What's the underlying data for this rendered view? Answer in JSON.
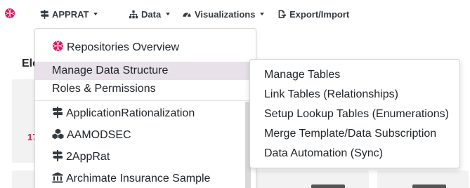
{
  "navbar": {
    "logo_icon": "appraat-logo-icon",
    "items": [
      {
        "label": "APPRAT",
        "icon": "signpost-icon"
      },
      {
        "label": "Data",
        "icon": "sitemap-icon"
      },
      {
        "label": "Visualizations",
        "icon": "tachometer-icon"
      },
      {
        "label": "Export/Import",
        "icon": "file-export-icon"
      }
    ]
  },
  "background": {
    "section_title": "Ele",
    "card_value": "17"
  },
  "dropdown": {
    "items": [
      {
        "label": "Repositories Overview",
        "icon": "appraat-logo-icon"
      },
      {
        "label": "Manage Data Structure",
        "active": true
      },
      {
        "label": "Roles & Permissions"
      },
      {
        "label": "ApplicationRationalization",
        "icon": "signpost-icon"
      },
      {
        "label": "AAMODSEC",
        "icon": "cubes-icon"
      },
      {
        "label": "2AppRat",
        "icon": "signpost-icon"
      },
      {
        "label": "Archimate Insurance Sample",
        "icon": "landmark-icon"
      }
    ]
  },
  "submenu": {
    "items": [
      {
        "label": "Manage Tables"
      },
      {
        "label": "Link Tables (Relationships)"
      },
      {
        "label": "Setup Lookup Tables (Enumerations)"
      },
      {
        "label": "Merge Template/Data Subscription"
      },
      {
        "label": "Data Automation (Sync)"
      }
    ]
  },
  "colors": {
    "accent": "#c2185b",
    "active_bg": "#e8e1e9",
    "nav_text": "#343a40"
  }
}
